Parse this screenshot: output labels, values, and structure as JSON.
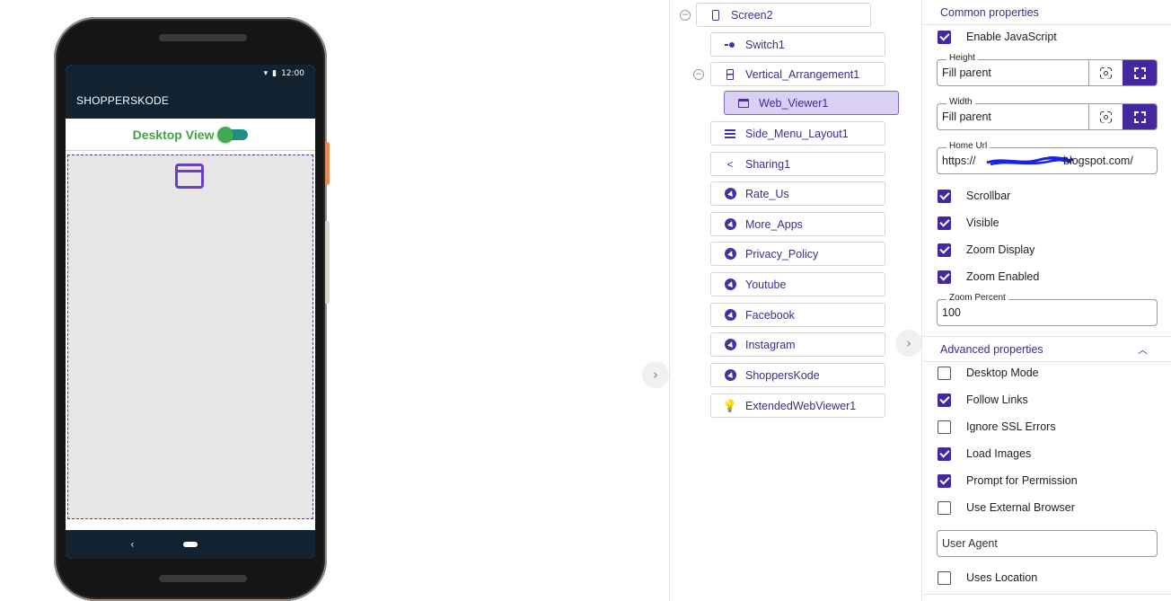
{
  "phone_preview": {
    "status_time": "12:00",
    "app_title": "SHOPPERSKODE",
    "switch_label": "Desktop View",
    "back_glyph": "‹"
  },
  "tree": {
    "items": [
      {
        "label": "Screen2",
        "icon": "phone-icon"
      },
      {
        "label": "Switch1",
        "icon": "switch-icon"
      },
      {
        "label": "Vertical_Arrangement1",
        "icon": "vertical-arrangement-icon"
      },
      {
        "label": "Web_Viewer1",
        "icon": "web-viewer-icon",
        "selected": true
      },
      {
        "label": "Side_Menu_Layout1",
        "icon": "list-icon"
      },
      {
        "label": "Sharing1",
        "icon": "share-icon"
      },
      {
        "label": "Rate_Us",
        "icon": "extension-icon"
      },
      {
        "label": "More_Apps",
        "icon": "extension-icon"
      },
      {
        "label": "Privacy_Policy",
        "icon": "extension-icon"
      },
      {
        "label": "Youtube",
        "icon": "extension-icon"
      },
      {
        "label": "Facebook",
        "icon": "extension-icon"
      },
      {
        "label": "Instagram",
        "icon": "extension-icon"
      },
      {
        "label": "ShoppersKode",
        "icon": "extension-icon"
      },
      {
        "label": "ExtendedWebViewer1",
        "icon": "lightbulb-icon"
      }
    ]
  },
  "properties": {
    "common_header": "Common properties",
    "enable_javascript": {
      "label": "Enable JavaScript",
      "checked": true
    },
    "height": {
      "legend": "Height",
      "value": "Fill parent"
    },
    "width": {
      "legend": "Width",
      "value": "Fill parent"
    },
    "home_url": {
      "legend": "Home Url",
      "prefix": "https://",
      "suffix": "blogspot.com/"
    },
    "scrollbar": {
      "label": "Scrollbar",
      "checked": true
    },
    "visible": {
      "label": "Visible",
      "checked": true
    },
    "zoom_display": {
      "label": "Zoom Display",
      "checked": true
    },
    "zoom_enabled": {
      "label": "Zoom Enabled",
      "checked": true
    },
    "zoom_percent": {
      "legend": "Zoom Percent",
      "value": "100"
    },
    "advanced_header": "Advanced properties",
    "desktop_mode": {
      "label": "Desktop Mode",
      "checked": false
    },
    "follow_links": {
      "label": "Follow Links",
      "checked": true
    },
    "ignore_ssl_errors": {
      "label": "Ignore SSL Errors",
      "checked": false
    },
    "load_images": {
      "label": "Load Images",
      "checked": true
    },
    "prompt_for_permission": {
      "label": "Prompt for Permission",
      "checked": true
    },
    "use_external_browser": {
      "label": "Use External Browser",
      "checked": false
    },
    "user_agent": {
      "placeholder": "User Agent"
    },
    "uses_location": {
      "label": "Uses Location",
      "checked": false
    }
  },
  "colors": {
    "accent": "#4527a0",
    "selected_bg": "#d9d0f3",
    "app_bar": "#112230",
    "switch_label": "#43a047"
  }
}
